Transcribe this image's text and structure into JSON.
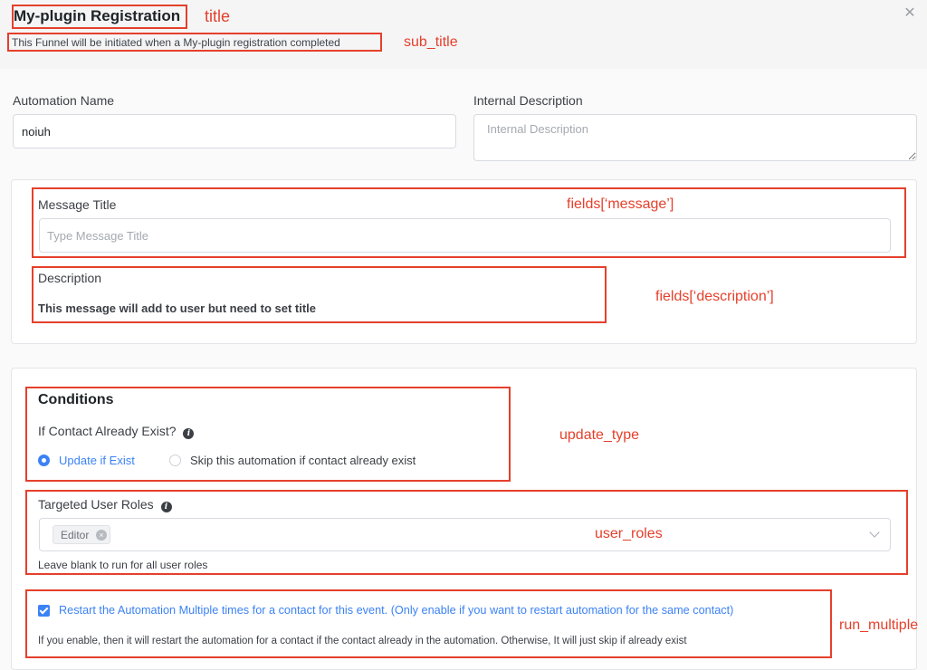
{
  "header": {
    "title": "My-plugin Registration",
    "subtitle": "This Funnel will be initiated when a My-plugin registration completed",
    "close_icon": "close-icon"
  },
  "form": {
    "automation_name_label": "Automation Name",
    "automation_name_value": "noiuh",
    "internal_description_label": "Internal Description",
    "internal_description_placeholder": "Internal Description"
  },
  "message_panel": {
    "message_title_label": "Message Title",
    "message_title_placeholder": "Type Message Title",
    "description_label": "Description",
    "description_text": "This message will add to user but need to set title"
  },
  "conditions": {
    "heading": "Conditions",
    "exist_question": "If Contact Already Exist?",
    "options": [
      {
        "label": "Update if Exist",
        "selected": true
      },
      {
        "label": "Skip this automation if contact already exist",
        "selected": false
      }
    ],
    "roles_label": "Targeted User Roles",
    "selected_roles": [
      "Editor"
    ],
    "roles_help": "Leave blank to run for all user roles",
    "run_multiple_label": "Restart the Automation Multiple times for a contact for this event. (Only enable if you want to restart automation for the same contact)",
    "run_multiple_checked": true,
    "run_multiple_help": "If you enable, then it will restart the automation for a contact if the contact already in the automation. Otherwise, It will just skip if already exist"
  },
  "annotations": {
    "title": "title",
    "sub_title": "sub_title",
    "message": "fields[‘message’]",
    "description": "fields[‘description’]",
    "update_type": "update_type",
    "user_roles": "user_roles",
    "run_multiple": "run_multiple"
  },
  "colors": {
    "accent": "#3b82f6",
    "annotation": "#e5402c"
  }
}
